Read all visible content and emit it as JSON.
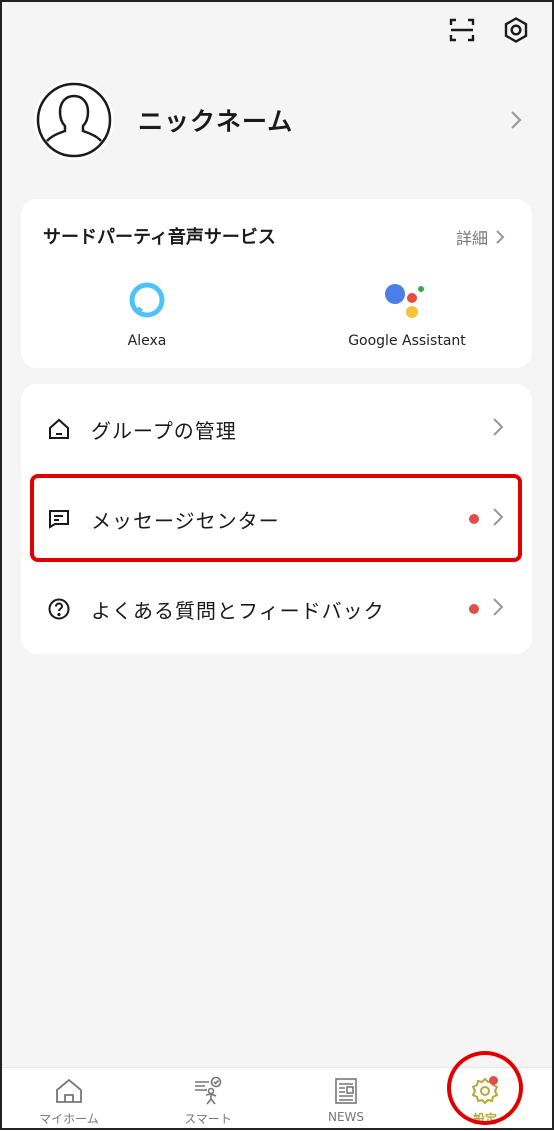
{
  "header": {
    "icons": [
      "scan-icon",
      "gear-icon"
    ]
  },
  "profile": {
    "nickname": "ニックネーム"
  },
  "voice_services": {
    "title": "サードパーティ音声サービス",
    "detail_label": "詳細",
    "services": [
      {
        "label": "Alexa",
        "icon": "alexa-icon"
      },
      {
        "label": "Google Assistant",
        "icon": "google-assistant-icon"
      }
    ]
  },
  "menu": {
    "items": [
      {
        "label": "グループの管理",
        "icon": "home-icon",
        "badge": false
      },
      {
        "label": "メッセージセンター",
        "icon": "message-icon",
        "badge": true
      },
      {
        "label": "よくある質問とフィードバック",
        "icon": "help-icon",
        "badge": true
      }
    ]
  },
  "bottom_nav": {
    "tabs": [
      {
        "label": "マイホーム",
        "icon": "home-icon"
      },
      {
        "label": "スマート",
        "icon": "smart-icon"
      },
      {
        "label": "NEWS",
        "icon": "news-icon"
      },
      {
        "label": "設定",
        "icon": "settings-icon",
        "active": true
      }
    ]
  },
  "colors": {
    "accent_active": "#b8a83a",
    "badge": "#e0504a",
    "highlight": "#e00000",
    "alexa": "#4fc3f7"
  }
}
